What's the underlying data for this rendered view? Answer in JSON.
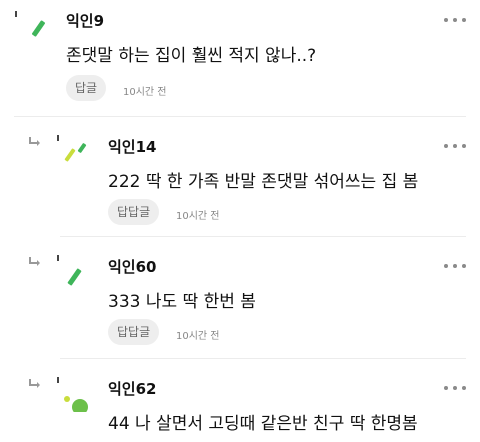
{
  "comments": [
    {
      "author": "익인9",
      "text": "존댓말 하는 집이 훨씬 적지 않나..?",
      "reply_label": "답글",
      "time": "10시간 전",
      "avatar_icon": "green-slash-avatar-icon"
    },
    {
      "author": "익인14",
      "text": "222 딱 한 가족 반말 존댓말 섞어쓰는 집 봄",
      "reply_label": "답답글",
      "time": "10시간 전",
      "avatar_icon": "lime-slashes-avatar-icon"
    },
    {
      "author": "익인60",
      "text": "333 나도 딱 한번 봄",
      "reply_label": "답답글",
      "time": "10시간 전",
      "avatar_icon": "green-slash-avatar-icon"
    },
    {
      "author": "익인62",
      "text": "44 나 살면서 고딩때 같은반 친구 딱 한명봄",
      "avatar_icon": "green-dots-avatar-icon"
    }
  ],
  "colors": {
    "avatar_green": "#3fb55a",
    "avatar_lime": "#c9dd3c",
    "avatar_mid": "#6cc04a"
  }
}
